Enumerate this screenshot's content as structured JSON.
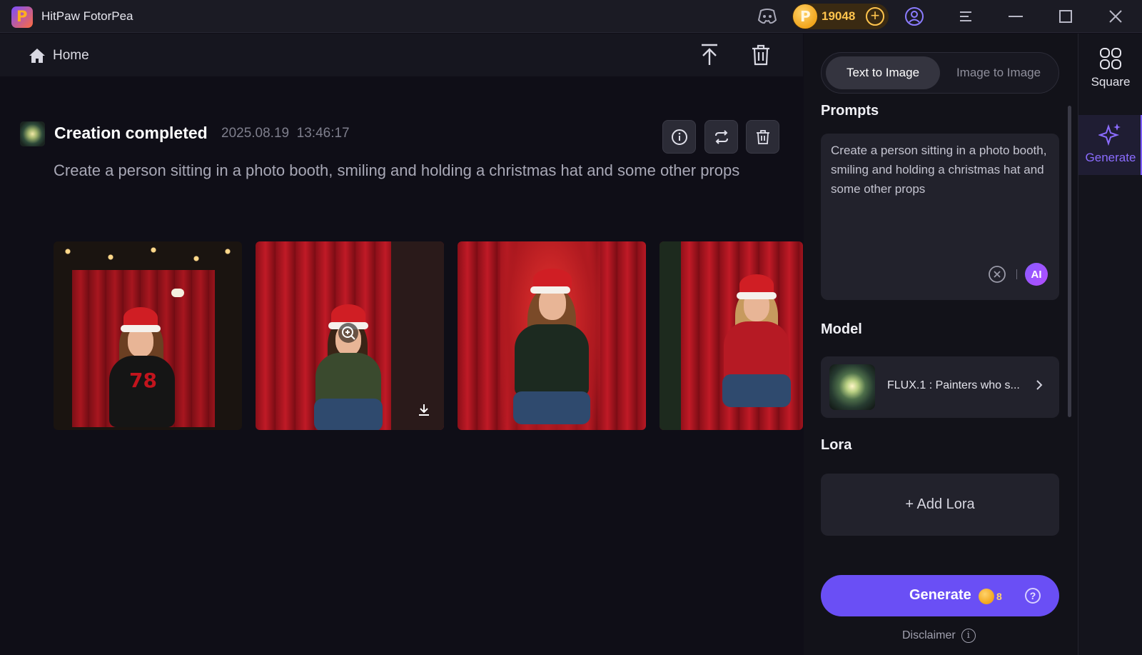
{
  "app": {
    "title": "HitPaw FotorPea",
    "credits": "19048"
  },
  "nav": {
    "home_label": "Home"
  },
  "task": {
    "status": "Creation completed",
    "date": "2025.08.19",
    "time": "13:46:17",
    "prompt": "Create a person sitting in a photo booth, smiling and holding a christmas hat and some other props"
  },
  "panel": {
    "tabs": [
      "Text to Image",
      "Image to Image"
    ],
    "active_tab": "Text to Image",
    "prompts_title": "Prompts",
    "prompt_value": "Create a person sitting in a photo booth, smiling and holding a christmas hat and some other props",
    "ai_label": "AI",
    "model_title": "Model",
    "model_name": "FLUX.1 : Painters who s...",
    "lora_title": "Lora",
    "add_lora": "+ Add Lora",
    "generate_label": "Generate",
    "generate_cost": "8",
    "disclaimer": "Disclaimer"
  },
  "rail": {
    "items": [
      {
        "label": "Square",
        "icon": "grid-squares-icon"
      },
      {
        "label": "Generate",
        "icon": "sparkle-icon"
      }
    ]
  },
  "colors": {
    "accent": "#6a4ff5",
    "credit": "#ffc44d",
    "background": "#0f0e17"
  }
}
